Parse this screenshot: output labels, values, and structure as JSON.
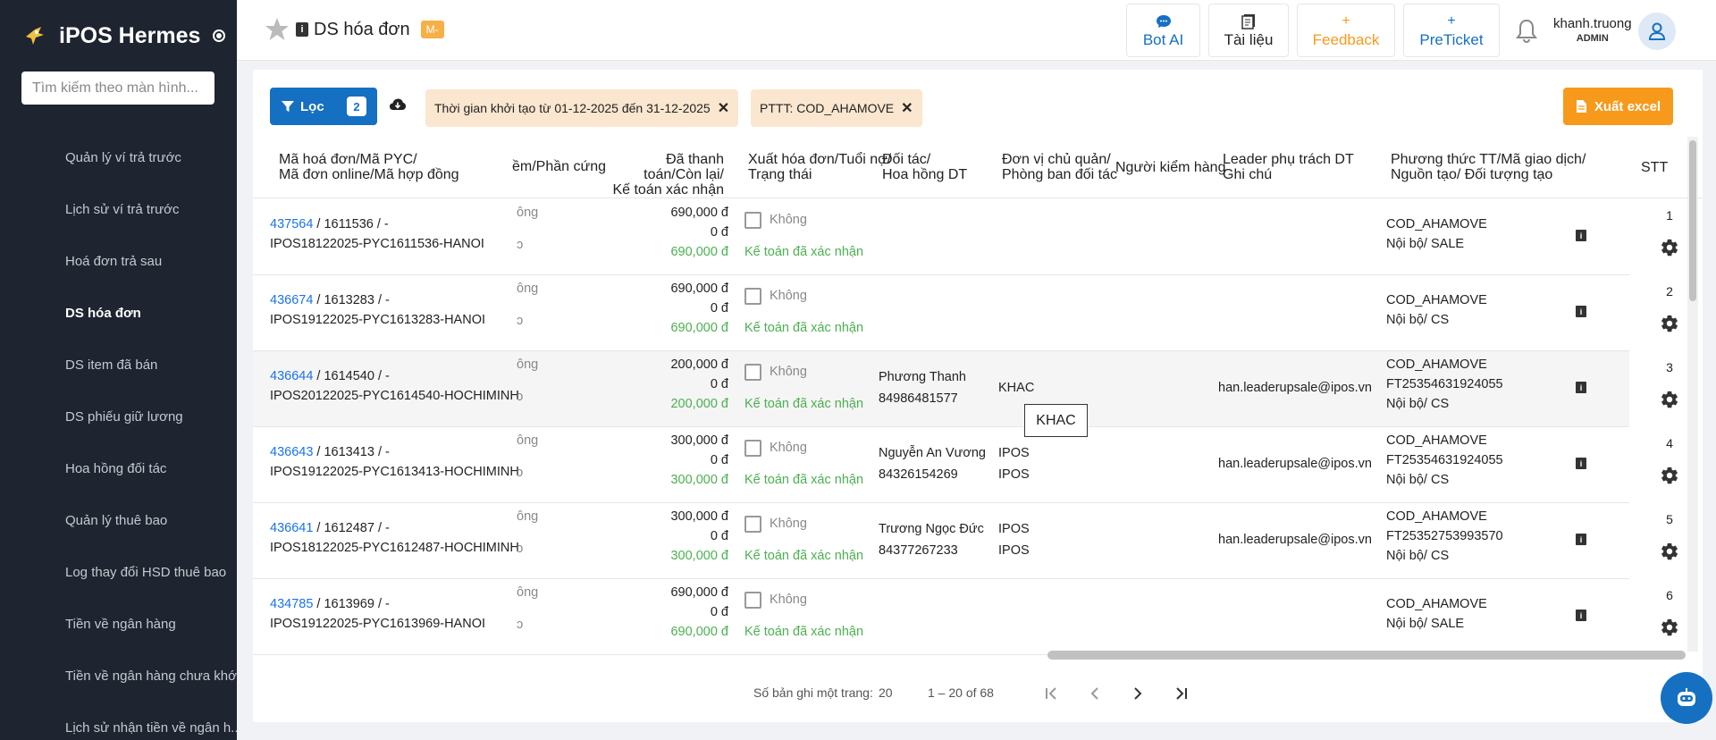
{
  "app": {
    "title": "iPOS Hermes"
  },
  "sidebar": {
    "search_placeholder": "Tìm kiếm theo màn hình...",
    "items": [
      {
        "label": "Quản lý ví trả trước"
      },
      {
        "label": "Lịch sử ví trả trước"
      },
      {
        "label": "Hoá đơn trả sau"
      },
      {
        "label": "DS hóa đơn"
      },
      {
        "label": "DS item đã bán"
      },
      {
        "label": "DS phiếu giữ lương"
      },
      {
        "label": "Hoa hồng đối tác"
      },
      {
        "label": "Quản lý thuê bao"
      },
      {
        "label": "Log thay đổi HSD thuê bao"
      },
      {
        "label": "Tiền về ngân hàng"
      },
      {
        "label": "Tiền về ngân hàng chưa khớp"
      },
      {
        "label": "Lịch sử nhận tiền về ngân h..."
      }
    ]
  },
  "header": {
    "page_title": "DS hóa đơn",
    "badge": "M-",
    "buttons": {
      "bot_ai": "Bot AI",
      "tai_lieu": "Tài liệu",
      "feedback": "Feedback",
      "preticket": "PreTicket"
    },
    "user_name": "khanh.truong",
    "user_role": "ADMIN"
  },
  "filters": {
    "filter_label": "Lọc",
    "filter_count": "2",
    "chips": [
      "Thời gian khởi tạo từ 01-12-2025 đến 31-12-2025",
      "PTTT: COD_AHAMOVE"
    ],
    "export_label": "Xuất excel"
  },
  "table": {
    "headers": {
      "code_1": "Mã hoá đơn/Mã PYC/",
      "code_2": "Mã đơn online/Mã hợp đồng",
      "hw": "ềm/Phần cứng",
      "paid_1": "Đã thanh toán/Còn lại/",
      "paid_2": "Kế toán xác nhận",
      "inv_1": "Xuất hóa đơn/Tuổi nợ/",
      "inv_2": "Trạng thái",
      "partner_1": "Đối tác/",
      "partner_2": "Hoa hồng DT",
      "unit_1": "Đơn vị chủ quản/",
      "unit_2": "Phòng ban đối tác",
      "checker": "Người kiểm hàng",
      "leader_1": "Leader phụ trách DT",
      "leader_2": "Ghi chú",
      "method_1": "Phương thức TT/Mã giao dịch/",
      "method_2": "Nguồn tạo/ Đối tượng tạo",
      "stt": "STT"
    },
    "rows": [
      {
        "id": "437564",
        "rest": " / 1611536 / -",
        "code": "IPOS18122025-PYC1611536-HANOI",
        "hw": "ông",
        "hw2": "ɔ",
        "paid": "690,000 đ",
        "remain": "0 đ",
        "confirmed": "690,000 đ",
        "invoice": "Không",
        "status": "Kế toán đã xác nhận",
        "partner": "",
        "partner_phone": "",
        "unit": "",
        "unit2": "",
        "leader": "",
        "method": "COD_AHAMOVE",
        "txn": "",
        "source": "Nội bộ/ SALE",
        "stt": "1"
      },
      {
        "id": "436674",
        "rest": " / 1613283 / -",
        "code": "IPOS19122025-PYC1613283-HANOI",
        "hw": "ông",
        "hw2": "ɔ",
        "paid": "690,000 đ",
        "remain": "0 đ",
        "confirmed": "690,000 đ",
        "invoice": "Không",
        "status": "Kế toán đã xác nhận",
        "partner": "",
        "partner_phone": "",
        "unit": "",
        "unit2": "",
        "leader": "",
        "method": "COD_AHAMOVE",
        "txn": "",
        "source": "Nội bộ/ CS",
        "stt": "2"
      },
      {
        "id": "436644",
        "rest": " / 1614540 / -",
        "code": "IPOS20122025-PYC1614540-HOCHIMINH",
        "hw": "ông",
        "hw2": "ɔ",
        "paid": "200,000 đ",
        "remain": "0 đ",
        "confirmed": "200,000 đ",
        "invoice": "Không",
        "status": "Kế toán đã xác nhận",
        "partner": "Phương Thanh",
        "partner_phone": "84986481577",
        "unit": "KHAC",
        "unit2": "",
        "leader": "han.leaderupsale@ipos.vn",
        "method": "COD_AHAMOVE",
        "txn": "FT25354631924055",
        "source": "Nội bộ/ CS",
        "stt": "3"
      },
      {
        "id": "436643",
        "rest": " / 1613413 / -",
        "code": "IPOS19122025-PYC1613413-HOCHIMINH",
        "hw": "ông",
        "hw2": "ɔ",
        "paid": "300,000 đ",
        "remain": "0 đ",
        "confirmed": "300,000 đ",
        "invoice": "Không",
        "status": "Kế toán đã xác nhận",
        "partner": "Nguyễn An Vương",
        "partner_phone": "84326154269",
        "unit": "IPOS",
        "unit2": "IPOS",
        "leader": "han.leaderupsale@ipos.vn",
        "method": "COD_AHAMOVE",
        "txn": "FT25354631924055",
        "source": "Nội bộ/ CS",
        "stt": "4"
      },
      {
        "id": "436641",
        "rest": " / 1612487 / -",
        "code": "IPOS18122025-PYC1612487-HOCHIMINH",
        "hw": "ông",
        "hw2": "ɔ",
        "paid": "300,000 đ",
        "remain": "0 đ",
        "confirmed": "300,000 đ",
        "invoice": "Không",
        "status": "Kế toán đã xác nhận",
        "partner": "Trương Ngọc Đức",
        "partner_phone": "84377267233",
        "unit": "IPOS",
        "unit2": "IPOS",
        "leader": "han.leaderupsale@ipos.vn",
        "method": "COD_AHAMOVE",
        "txn": "FT25352753993570",
        "source": "Nội bộ/ CS",
        "stt": "5"
      },
      {
        "id": "434785",
        "rest": " / 1613969 / -",
        "code": "IPOS19122025-PYC1613969-HANOI",
        "hw": "ông",
        "hw2": "ɔ",
        "paid": "690,000 đ",
        "remain": "0 đ",
        "confirmed": "690,000 đ",
        "invoice": "Không",
        "status": "Kế toán đã xác nhận",
        "partner": "",
        "partner_phone": "",
        "unit": "",
        "unit2": "",
        "leader": "",
        "method": "COD_AHAMOVE",
        "txn": "",
        "source": "Nội bộ/ SALE",
        "stt": "6"
      }
    ]
  },
  "tooltip": "KHAC",
  "pagination": {
    "per_page_label": "Số bản ghi một trang:",
    "per_page": "20",
    "range": "1 – 20 of 68"
  },
  "colors": {
    "sidebar_bg": "#1e2430",
    "primary": "#1570c2",
    "accent": "#f79a1c",
    "chip": "#fbe6cf",
    "link": "#1a73e8",
    "confirmed": "#4caf50"
  }
}
